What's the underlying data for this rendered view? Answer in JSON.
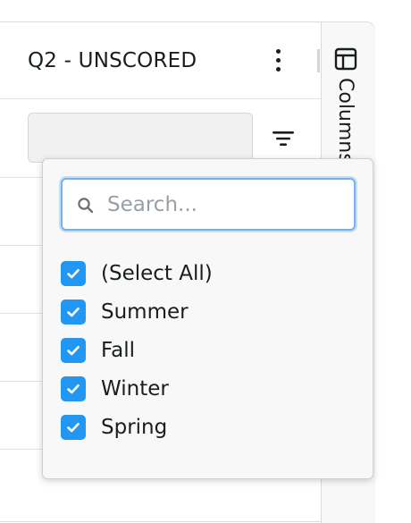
{
  "column": {
    "title": "Q2 - UNSCORED",
    "menu_icon": "kebab-menu-icon",
    "filter_icon": "filter-icon"
  },
  "side_panel": {
    "tab_label": "Columns",
    "tab_icon": "columns-icon"
  },
  "filter_popup": {
    "search": {
      "placeholder": "Search...",
      "value": ""
    },
    "options": [
      {
        "label": "(Select All)",
        "checked": true
      },
      {
        "label": "Summer",
        "checked": true
      },
      {
        "label": "Fall",
        "checked": true
      },
      {
        "label": "Winter",
        "checked": true
      },
      {
        "label": "Spring",
        "checked": true
      }
    ]
  },
  "colors": {
    "accent": "#2196f3",
    "focus_border": "#7ab0ea"
  }
}
